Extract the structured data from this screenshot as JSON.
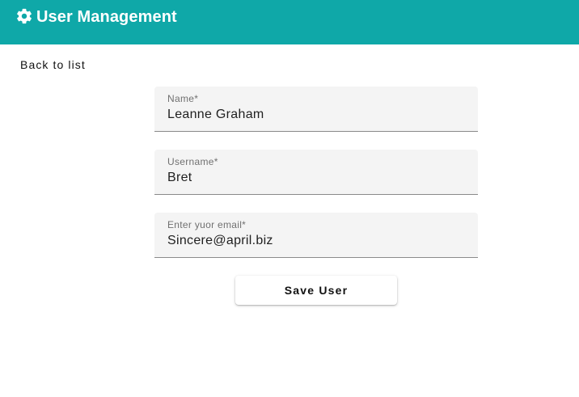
{
  "header": {
    "title": "User Management",
    "icon": "gear-icon",
    "background_color": "#0fa8a8"
  },
  "nav": {
    "back_label": "Back to list"
  },
  "form": {
    "fields": [
      {
        "label": "Name*",
        "value": "Leanne Graham"
      },
      {
        "label": "Username*",
        "value": "Bret"
      },
      {
        "label": "Enter yuor email*",
        "value": "Sincere@april.biz"
      }
    ],
    "save_label": "Save User"
  }
}
